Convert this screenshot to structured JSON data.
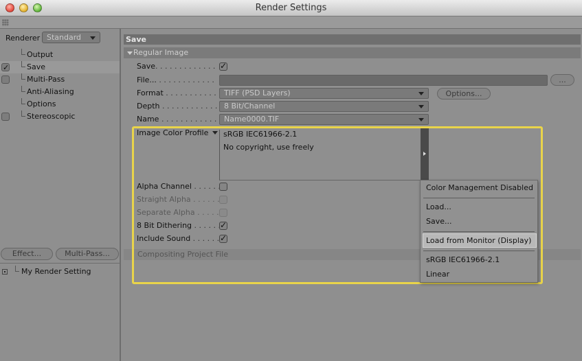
{
  "window": {
    "title": "Render Settings"
  },
  "left": {
    "renderer_label": "Renderer",
    "renderer_value": "Standard",
    "tree": [
      {
        "label": "Output",
        "checkbox": false,
        "checked": false,
        "selected": false
      },
      {
        "label": "Save",
        "checkbox": true,
        "checked": true,
        "selected": true
      },
      {
        "label": "Multi-Pass",
        "checkbox": true,
        "checked": false,
        "selected": false
      },
      {
        "label": "Anti-Aliasing",
        "checkbox": false,
        "checked": false,
        "selected": false
      },
      {
        "label": "Options",
        "checkbox": false,
        "checked": false,
        "selected": false
      },
      {
        "label": "Stereoscopic",
        "checkbox": true,
        "checked": false,
        "selected": false
      }
    ],
    "effect_button": "Effect...",
    "multipass_button": "Multi-Pass...",
    "render_setting": "My Render Setting"
  },
  "right": {
    "save_header": "Save",
    "regular_image_header": "Regular Image",
    "save_label": "Save",
    "file_label": "File...",
    "file_value": "",
    "file_browse": "...",
    "format_label": "Format",
    "format_value": "TIFF (PSD Layers)",
    "options_button": "Options...",
    "depth_label": "Depth",
    "depth_value": "8 Bit/Channel",
    "name_label": "Name",
    "name_value": "Name0000.TIF",
    "profile_label": "Image Color Profile",
    "profile_line1": "sRGB IEC61966-2.1",
    "profile_line2": "No copyright, use freely",
    "alpha_label": "Alpha Channel",
    "straight_alpha_label": "Straight Alpha",
    "separate_alpha_label": "Separate Alpha",
    "dithering_label": "8 Bit Dithering",
    "sound_label": "Include Sound",
    "compositing_header": "Compositing Project File"
  },
  "menu": {
    "items": [
      "Color Management Disabled",
      "Load...",
      "Save...",
      "Load from Monitor (Display)",
      "sRGB IEC61966-2.1",
      "Linear"
    ],
    "highlighted": "Load from Monitor (Display)"
  },
  "checkmarks": {
    "check": "✓"
  },
  "colors": {
    "highlight_border": "#e9d44a",
    "panel": "#8f8f8f",
    "section_header": "#6f6f6f"
  },
  "icons": {
    "grip": "grip-icon",
    "tree_expand": "expand-box-icon",
    "dropdown": "chevron-down-icon",
    "submenu": "chevron-right-icon"
  }
}
